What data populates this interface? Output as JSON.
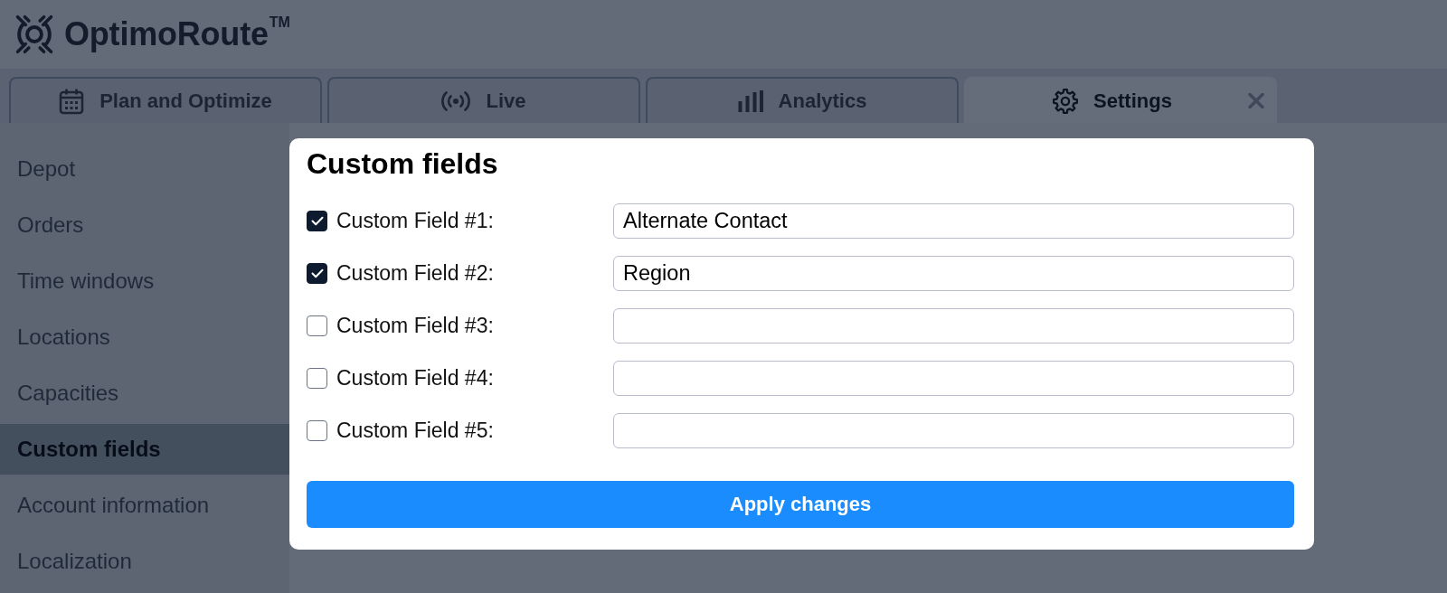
{
  "brand": {
    "name": "OptimoRoute",
    "mark": "TM"
  },
  "tabs": [
    {
      "label": "Plan and Optimize",
      "selected": false,
      "closable": false
    },
    {
      "label": "Live",
      "selected": false,
      "closable": false
    },
    {
      "label": "Analytics",
      "selected": false,
      "closable": false
    },
    {
      "label": "Settings",
      "selected": true,
      "closable": true
    }
  ],
  "sidebar": {
    "items": [
      {
        "label": "Depot",
        "selected": false
      },
      {
        "label": "Orders",
        "selected": false
      },
      {
        "label": "Time windows",
        "selected": false
      },
      {
        "label": "Locations",
        "selected": false
      },
      {
        "label": "Capacities",
        "selected": false
      },
      {
        "label": "Custom fields",
        "selected": true
      },
      {
        "label": "Account information",
        "selected": false
      },
      {
        "label": "Localization",
        "selected": false
      }
    ]
  },
  "dialog": {
    "title": "Custom fields",
    "fields": [
      {
        "label": "Custom Field #1:",
        "checked": true,
        "value": "Alternate Contact"
      },
      {
        "label": "Custom Field #2:",
        "checked": true,
        "value": "Region"
      },
      {
        "label": "Custom Field #3:",
        "checked": false
      },
      {
        "label": "Custom Field #4:",
        "checked": false
      },
      {
        "label": "Custom Field #5:",
        "checked": false
      }
    ],
    "button": "Apply changes"
  }
}
